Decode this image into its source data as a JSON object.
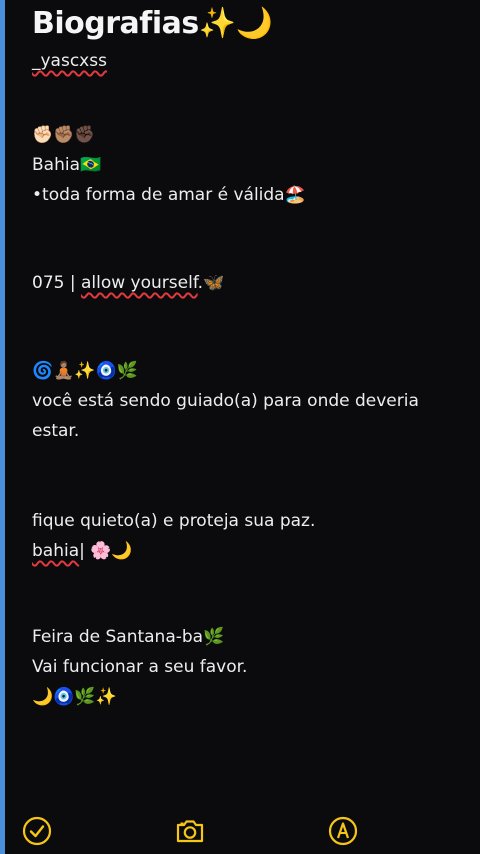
{
  "note": {
    "title": "Biografias✨🌙",
    "handle": "_yascxss",
    "lines": [
      "✊🏻✊🏽✊🏿",
      "Bahia🇧🇷",
      "•toda forma de amar  é válida🏖️",
      "075 | allow yourself.🦋",
      "🌀🧘🏽✨🧿🌿",
      "você está sendo guiado(a) para onde deveria estar.",
      "fique quieto(a) e proteja sua paz.",
      "bahia| 🌸🌙",
      "Feira de Santana-ba🌿",
      "Vai funcionar a seu favor.",
      "🌙🧿🌿✨"
    ]
  },
  "toolbar": {
    "icons": [
      "checkmark-circle-icon",
      "camera-icon",
      "markup-pen-icon"
    ]
  },
  "colors": {
    "background": "#0b0b0d",
    "accent": "#f5c518",
    "spellcheck": "#e0393e",
    "edge": "#4a90d9"
  }
}
